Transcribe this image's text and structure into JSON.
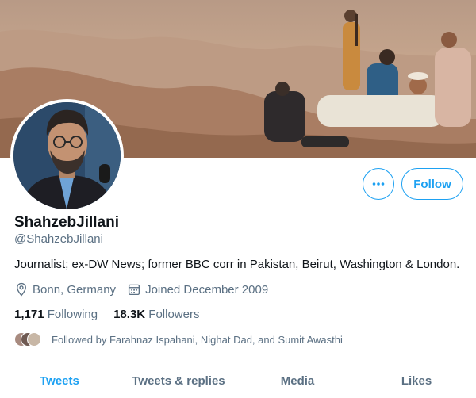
{
  "profile": {
    "display_name": "ShahzebJillani",
    "handle": "@ShahzebJillani",
    "bio": "Journalist; ex-DW News; former BBC corr in Pakistan, Beirut, Washington & London.",
    "location": "Bonn, Germany",
    "joined": "Joined December 2009",
    "location_icon": "map-pin-icon",
    "joined_icon": "calendar-icon"
  },
  "actions": {
    "more_icon": "more-horizontal-icon",
    "follow_label": "Follow"
  },
  "stats": {
    "following_count": "1,171",
    "following_label": "Following",
    "followers_count": "18.3K",
    "followers_label": "Followers"
  },
  "followed_by": {
    "text": "Followed by Farahnaz Ispahani, Nighat Dad, and Sumit Awasthi"
  },
  "tabs": [
    {
      "label": "Tweets",
      "active": true
    },
    {
      "label": "Tweets & replies",
      "active": false
    },
    {
      "label": "Media",
      "active": false
    },
    {
      "label": "Likes",
      "active": false
    }
  ],
  "colors": {
    "accent": "#1da1f2",
    "text_primary": "#0f1419",
    "text_secondary": "#5b7083"
  }
}
